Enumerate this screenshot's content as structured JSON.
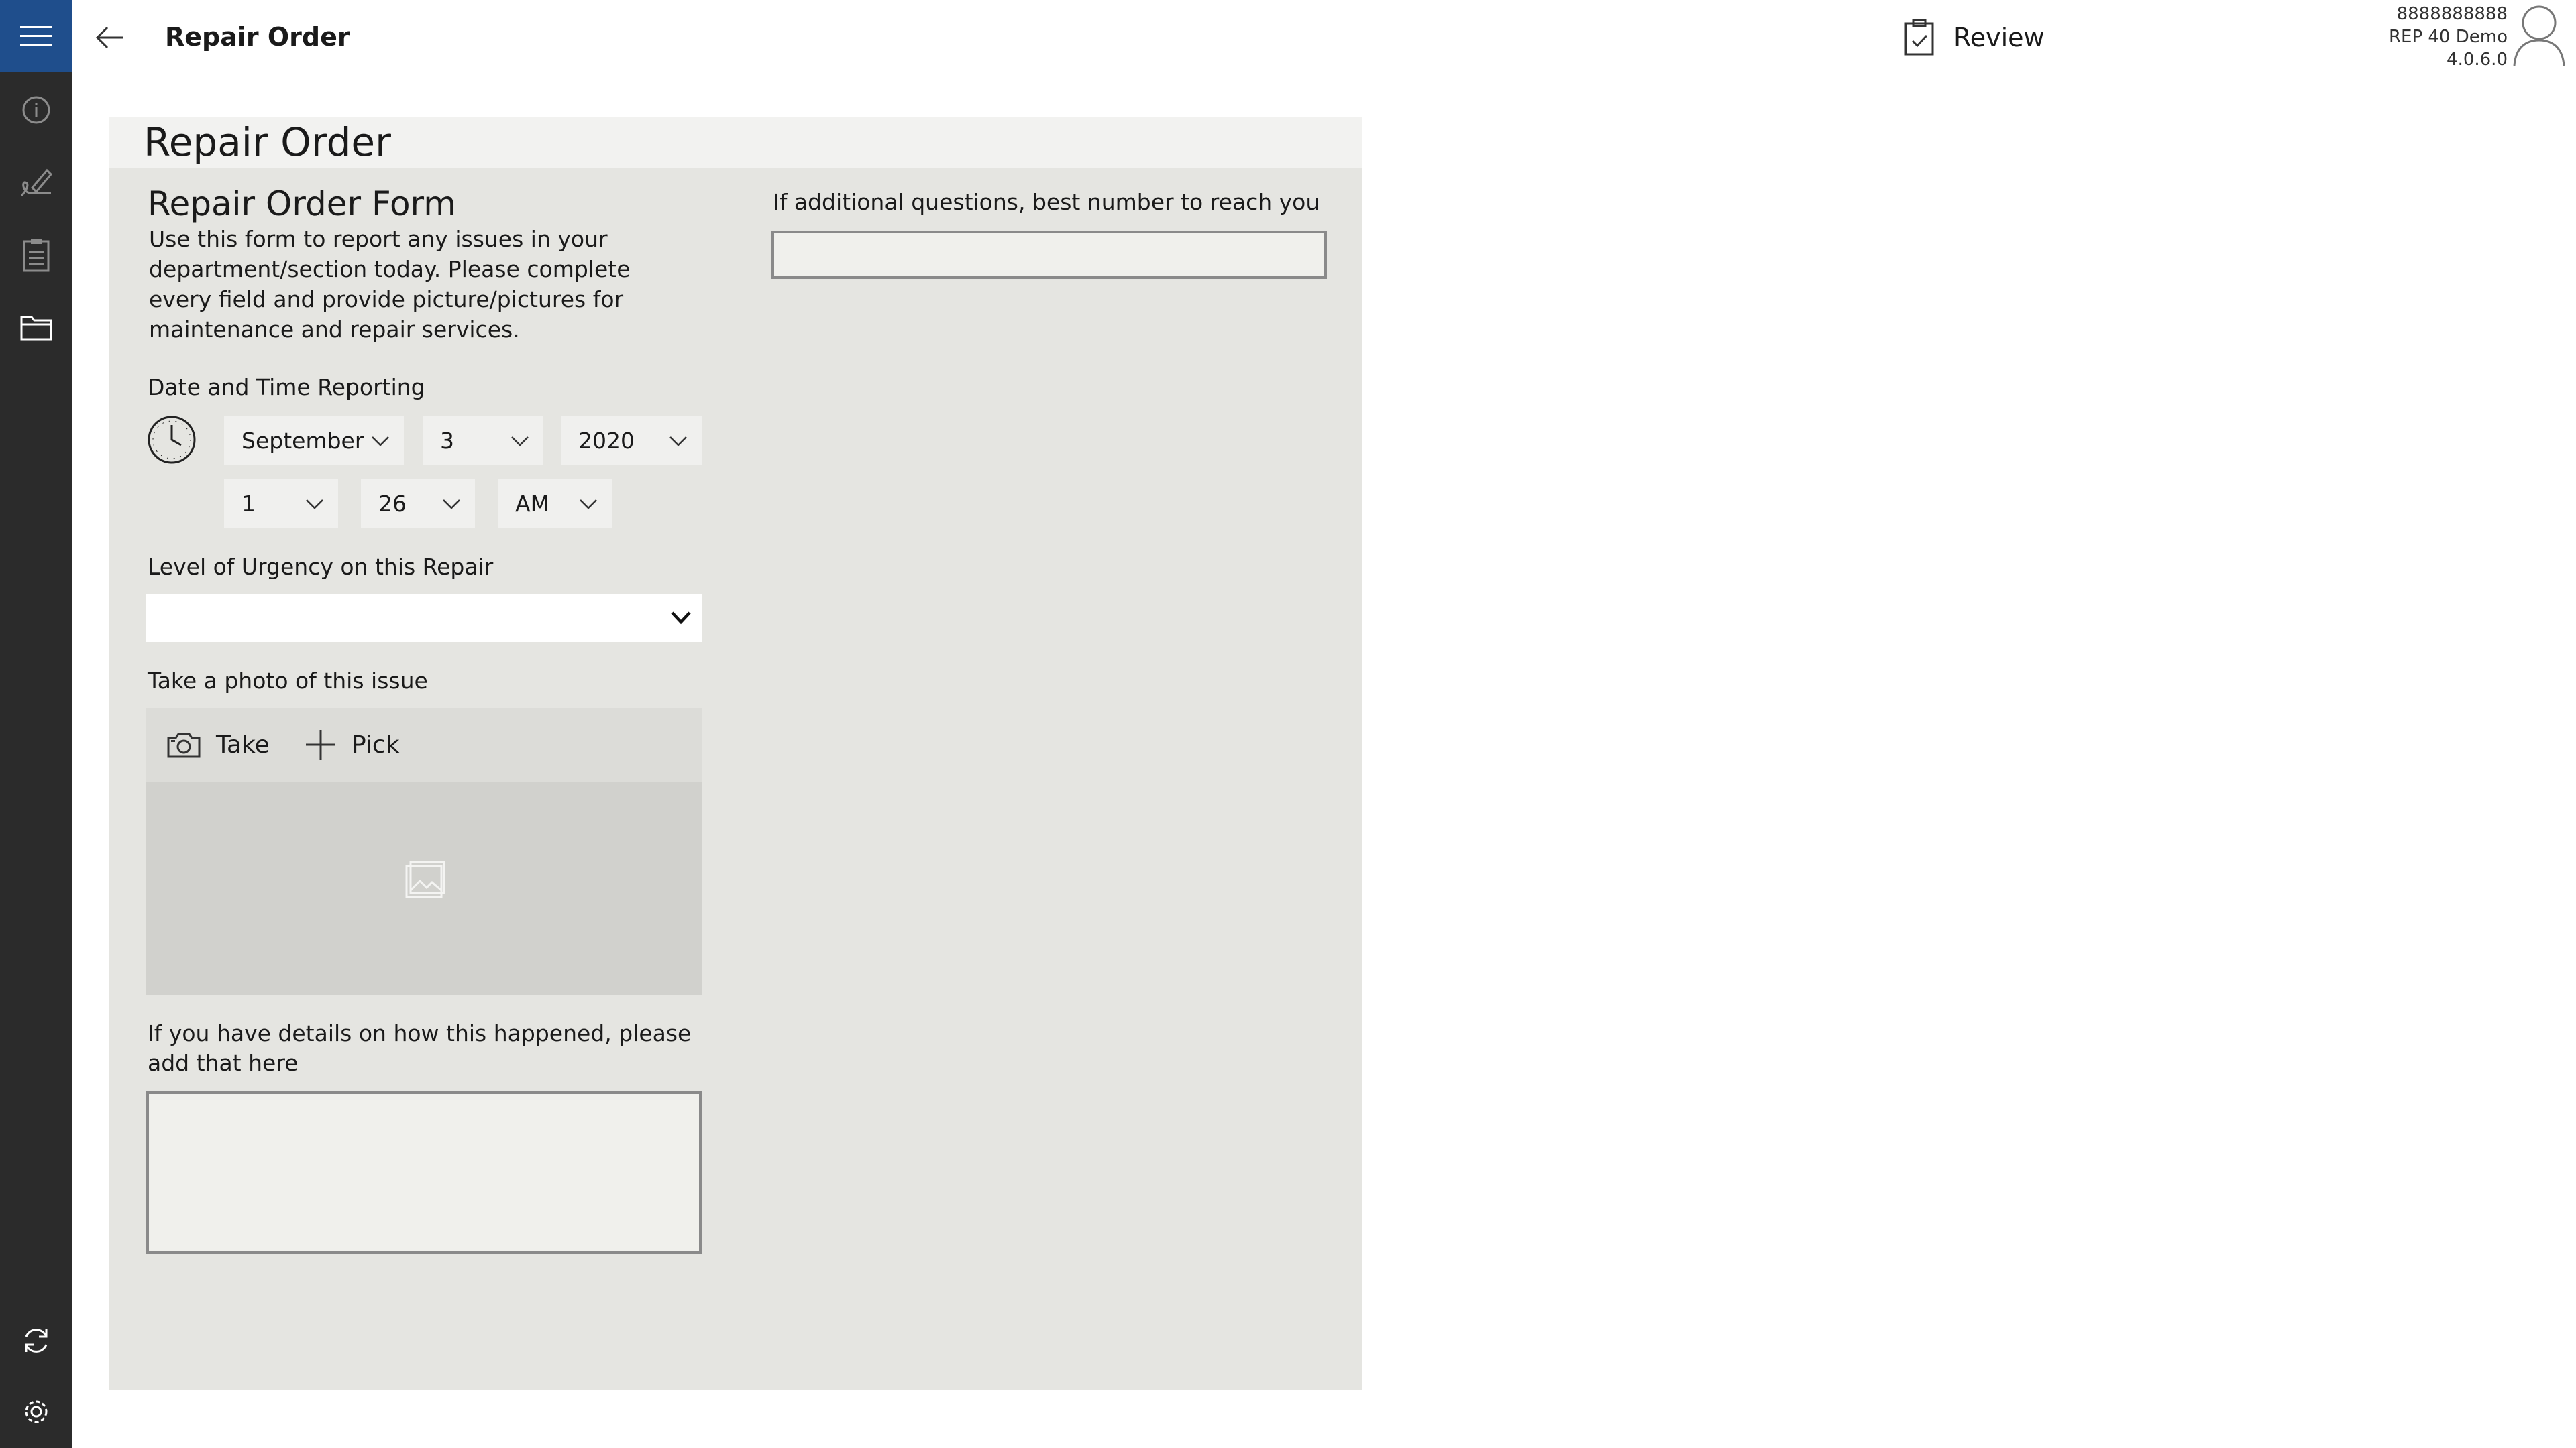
{
  "header": {
    "title": "Repair Order",
    "review_label": "Review"
  },
  "user": {
    "line1": "8888888888",
    "line2": "REP 40 Demo",
    "line3": "4.0.6.0"
  },
  "sidebar": {
    "items": [
      {
        "icon": "info-icon"
      },
      {
        "icon": "signature-icon"
      },
      {
        "icon": "clipboard-icon"
      },
      {
        "icon": "folder-icon"
      }
    ],
    "bottom": [
      {
        "icon": "sync-icon"
      },
      {
        "icon": "gear-icon"
      }
    ]
  },
  "card": {
    "title": "Repair Order"
  },
  "form": {
    "title": "Repair Order Form",
    "description": "Use this form to report any issues in your department/section today. Please complete every field and provide picture/pictures for maintenance and repair services.",
    "date_label": "Date and Time Reporting",
    "date": {
      "month": "September",
      "day": "3",
      "year": "2020",
      "hour": "1",
      "minute": "26",
      "ampm": "AM"
    },
    "urgency_label": "Level of Urgency on this Repair",
    "urgency_value": "",
    "photo_label": "Take a photo of this issue",
    "take_label": "Take",
    "pick_label": "Pick",
    "details_label": "If you have details on how this happened, please add that here",
    "details_value": "",
    "phone_label": "If additional questions, best number to reach you",
    "phone_value": ""
  },
  "colors": {
    "accent": "#1f4e8c",
    "sidebar": "#2b2b2b",
    "card": "#e5e5e1"
  }
}
